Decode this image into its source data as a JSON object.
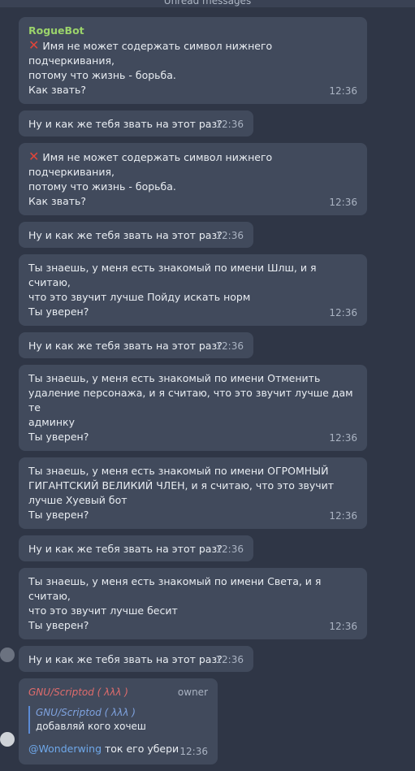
{
  "unread_label": "Unread messages",
  "messages": [
    {
      "sender": "RogueBot",
      "lines": [
        "Имя не может содержать символ нижнего подчеркивания,",
        "потому что жизнь - борьба.",
        "Как звать?"
      ],
      "time": "12:36",
      "cross": true
    },
    {
      "lines": [
        "Ну и как же тебя звать на этот раз?"
      ],
      "time": "12:36"
    },
    {
      "lines": [
        "Имя не может содержать символ нижнего подчеркивания,",
        "потому что жизнь - борьба.",
        "Как звать?"
      ],
      "time": "12:36",
      "cross": true
    },
    {
      "lines": [
        "Ну и как же тебя звать на этот раз?"
      ],
      "time": "12:36"
    },
    {
      "lines": [
        "Ты знаешь, у меня есть знакомый по имени Шлш, и я считаю,",
        "что это звучит лучше Пойду искать норм",
        "Ты уверен?"
      ],
      "time": "12:36"
    },
    {
      "lines": [
        "Ну и как же тебя звать на этот раз?"
      ],
      "time": "12:36"
    },
    {
      "lines": [
        "Ты знаешь, у меня есть знакомый по имени Отменить",
        "удаление персонажа, и я считаю, что это звучит лучше дам те",
        "админку",
        "Ты уверен?"
      ],
      "time": "12:36"
    },
    {
      "lines": [
        "Ты знаешь, у меня есть знакомый по имени ОГРОМНЫЙ",
        "ГИГАНТСКИЙ ВЕЛИКИЙ ЧЛЕН, и я считаю, что это звучит",
        "лучше Хуевый бот",
        "Ты уверен?"
      ],
      "time": "12:36"
    },
    {
      "lines": [
        "Ну и как же тебя звать на этот раз?"
      ],
      "time": "12:36"
    },
    {
      "lines": [
        "Ты знаешь, у меня есть знакомый по имени Света, и я считаю,",
        "что это звучит лучше бесит",
        "Ты уверен?"
      ],
      "time": "12:36"
    },
    {
      "lines": [
        "Ну и как же тебя звать на этот раз?"
      ],
      "time": "12:36"
    }
  ],
  "reply_message": {
    "sender": "GNU/Scriptod ( λλλ )",
    "role": "owner",
    "quote_sender": "GNU/Scriptod ( λλλ )",
    "quote_text": "добавляй кого хочеш",
    "mention": "@Wonderwing",
    "text": " ток его убери",
    "time": "12:36"
  }
}
